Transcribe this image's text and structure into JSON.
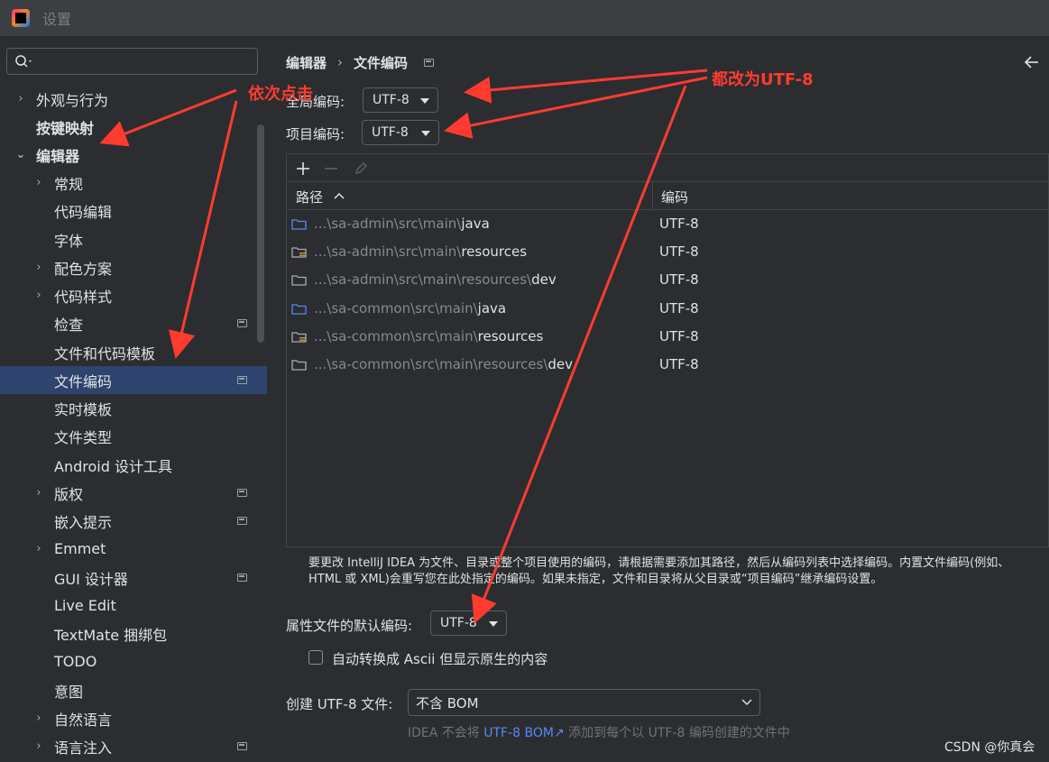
{
  "window": {
    "title": "设置"
  },
  "search": {
    "placeholder": ""
  },
  "sidebar": {
    "items": [
      {
        "label": "外观与行为"
      },
      {
        "label": "按键映射"
      },
      {
        "label": "编辑器"
      },
      {
        "label": "常规"
      },
      {
        "label": "代码编辑"
      },
      {
        "label": "字体"
      },
      {
        "label": "配色方案"
      },
      {
        "label": "代码样式"
      },
      {
        "label": "检查"
      },
      {
        "label": "文件和代码模板"
      },
      {
        "label": "文件编码"
      },
      {
        "label": "实时模板"
      },
      {
        "label": "文件类型"
      },
      {
        "label": "Android 设计工具"
      },
      {
        "label": "版权"
      },
      {
        "label": "嵌入提示"
      },
      {
        "label": "Emmet"
      },
      {
        "label": "GUI 设计器"
      },
      {
        "label": "Live Edit"
      },
      {
        "label": "TextMate 捆绑包"
      },
      {
        "label": "TODO"
      },
      {
        "label": "意图"
      },
      {
        "label": "自然语言"
      },
      {
        "label": "语言注入"
      }
    ]
  },
  "breadcrumb": {
    "parent": "编辑器",
    "sep": "›",
    "current": "文件编码"
  },
  "form": {
    "global_label": "全局编码:",
    "global_value": "UTF-8",
    "project_label": "项目编码:",
    "project_value": "UTF-8",
    "properties_label": "属性文件的默认编码:",
    "properties_value": "UTF-8",
    "ascii_label": "自动转换成 Ascii 但显示原生的内容",
    "create_label": "创建 UTF-8 文件:",
    "create_value": "不含 BOM",
    "hint_prefix": "IDEA 不会将",
    "hint_link": "UTF-8 BOM",
    "hint_suffix": "添加到每个以 UTF-8 编码创建的文件中"
  },
  "table": {
    "col_path": "路径",
    "col_encoding": "编码",
    "rows": [
      {
        "dim": "...\\sa-admin\\src\\main\\",
        "hi": "java",
        "enc": "UTF-8",
        "icon": "source-folder-icon",
        "color": "#548af7"
      },
      {
        "dim": "...\\sa-admin\\src\\main\\",
        "hi": "resources",
        "enc": "UTF-8",
        "icon": "resources-folder-icon",
        "color": "#c9a24a"
      },
      {
        "dim": "...\\sa-admin\\src\\main\\resources\\",
        "hi": "dev",
        "enc": "UTF-8",
        "icon": "folder-icon",
        "color": "#a9acb2"
      },
      {
        "dim": "...\\sa-common\\src\\main\\",
        "hi": "java",
        "enc": "UTF-8",
        "icon": "source-folder-icon",
        "color": "#548af7"
      },
      {
        "dim": "...\\sa-common\\src\\main\\",
        "hi": "resources",
        "enc": "UTF-8",
        "icon": "resources-folder-icon",
        "color": "#c9a24a"
      },
      {
        "dim": "...\\sa-common\\src\\main\\resources\\",
        "hi": "dev",
        "enc": "UTF-8",
        "icon": "folder-icon",
        "color": "#a9acb2"
      }
    ]
  },
  "description": {
    "line1": "要更改 IntelliJ IDEA 为文件、目录或整个项目使用的编码，请根据需要添加其路径，然后从编码列表中选择编码。内置文件编码(例如、",
    "line2": "HTML 或 XML)会重写您在此处指定的编码。如果未指定，文件和目录将从父目录或“项目编码”继承编码设置。"
  },
  "annotations": {
    "click_order": "依次点击",
    "change_all": "都改为UTF-8",
    "color": "#ff3b30"
  },
  "watermark": "CSDN @你真会"
}
